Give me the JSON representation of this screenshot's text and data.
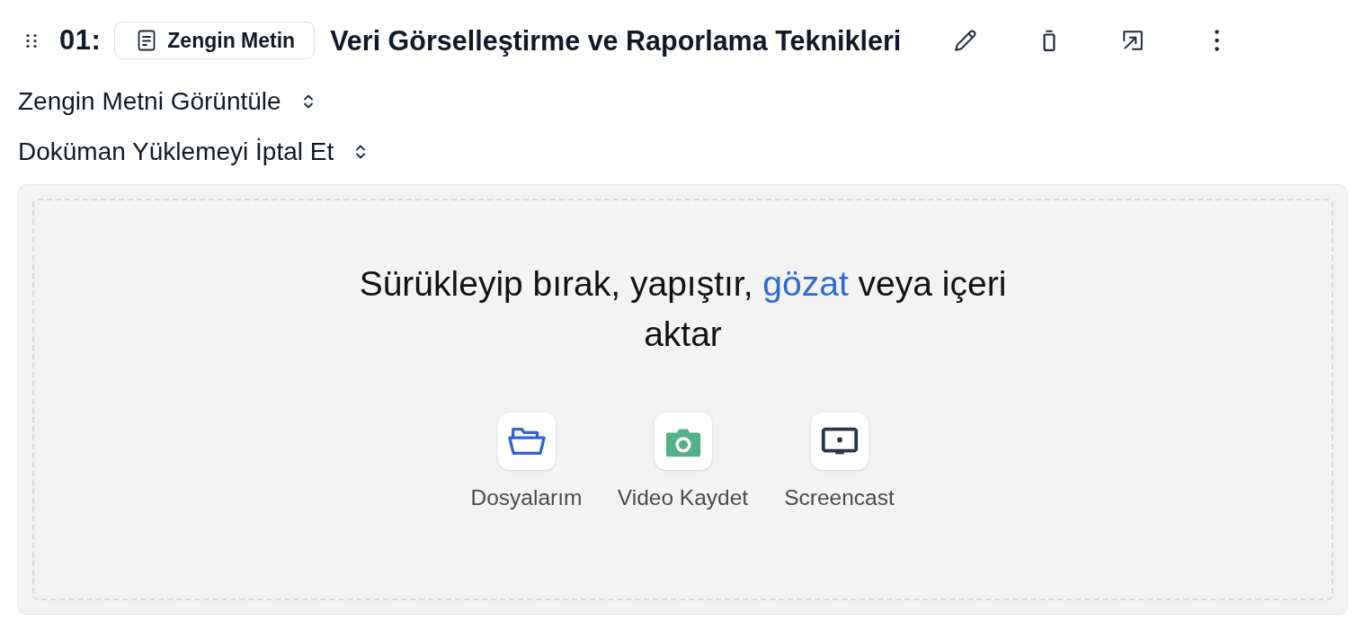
{
  "header": {
    "number": "01:",
    "badge": {
      "label": "Zengin Metin"
    },
    "title": "Veri Görselleştirme ve Raporlama Teknikleri",
    "actions": [
      {
        "kind": "edit"
      },
      {
        "kind": "delete"
      },
      {
        "kind": "expand"
      },
      {
        "kind": "more"
      }
    ]
  },
  "toggles": [
    {
      "label": "Zengin Metni Görüntüle"
    },
    {
      "label": "Doküman Yüklemeyi İptal Et"
    }
  ],
  "dropzone": {
    "prompt_before": "Sürükleyip bırak, yapıştır,",
    "link": "gözat",
    "prompt_after": "veya içeri aktar",
    "sources": [
      {
        "kind": "files",
        "label": "Dosyalarım"
      },
      {
        "kind": "camera",
        "label": "Video Kaydet"
      },
      {
        "kind": "screencast",
        "label": "Screencast"
      }
    ]
  }
}
